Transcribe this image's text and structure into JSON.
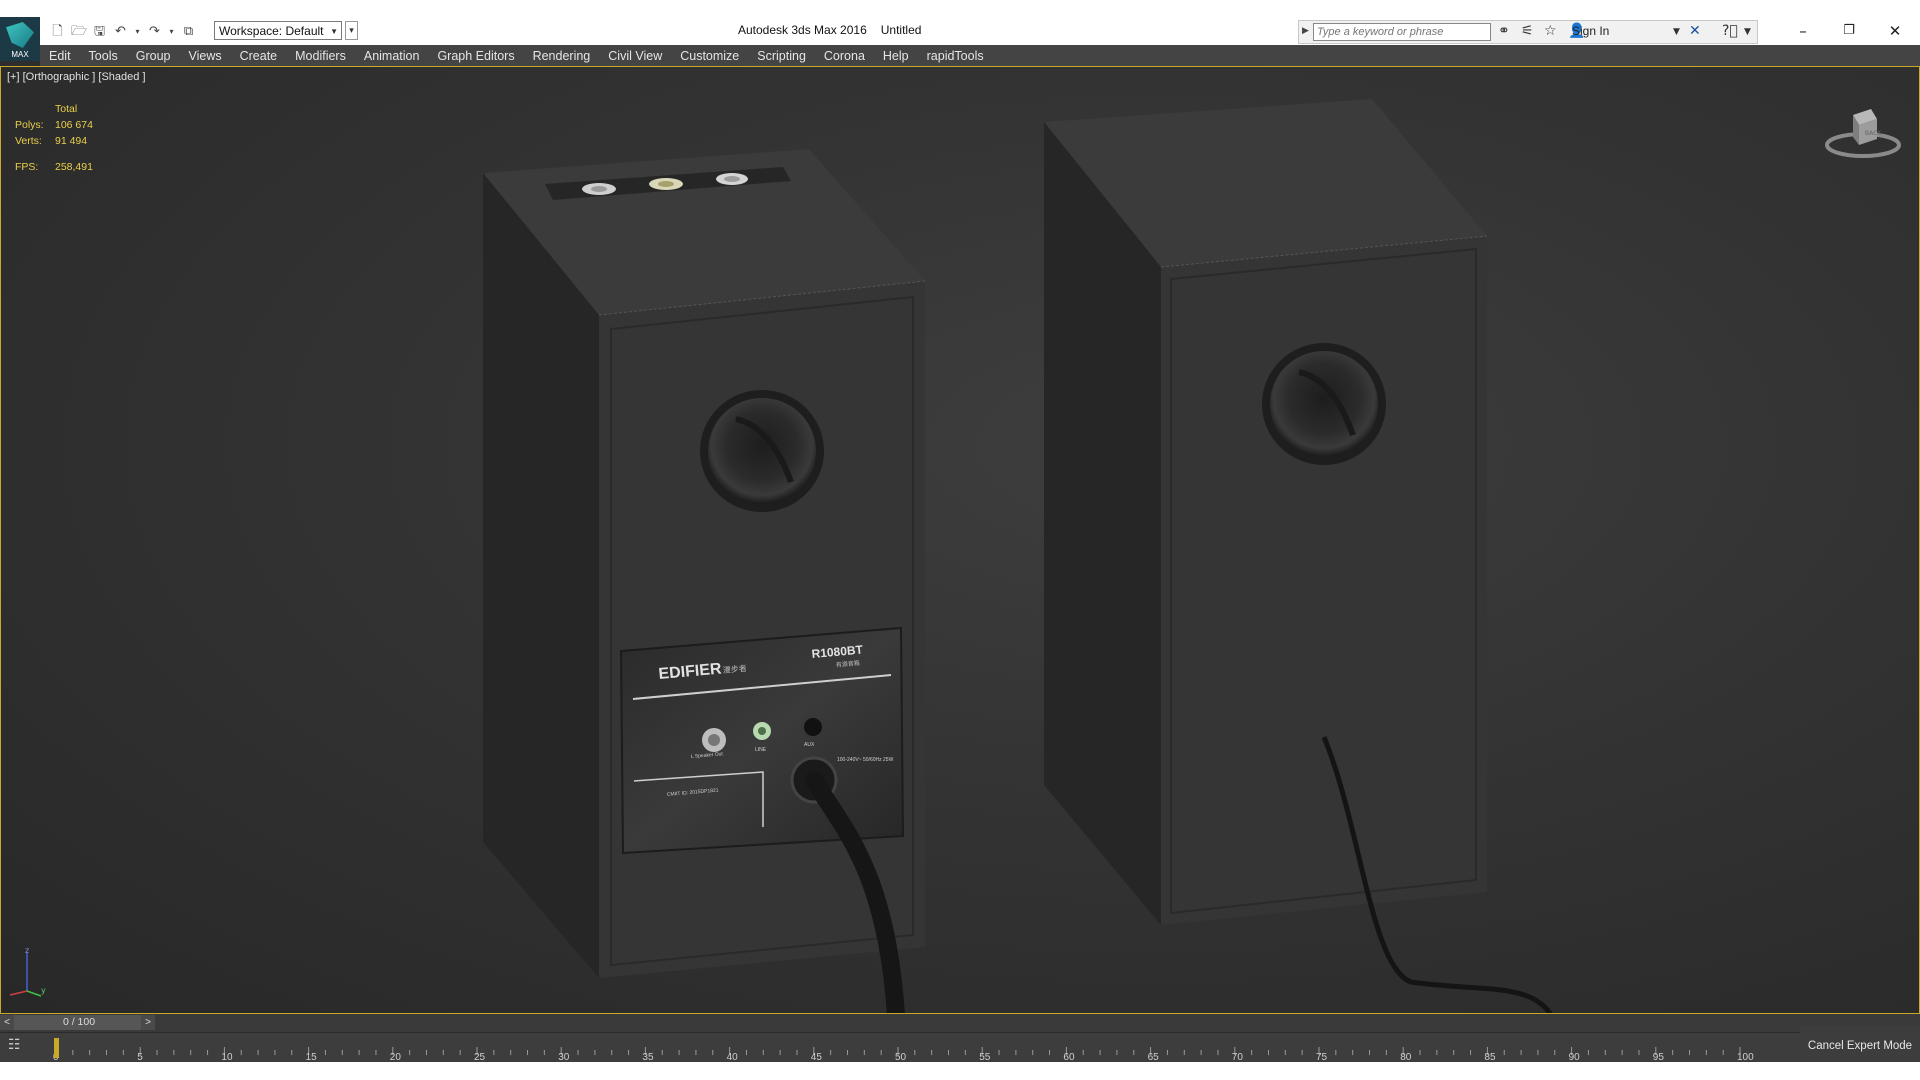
{
  "app": {
    "product": "Autodesk 3ds Max 2016",
    "document": "Untitled",
    "logo_text": "MAX"
  },
  "toolbar": {
    "workspace_label": "Workspace: Default"
  },
  "search": {
    "placeholder": "Type a keyword or phrase"
  },
  "account": {
    "sign_in_label": "Sign In"
  },
  "menu": {
    "items": [
      "Edit",
      "Tools",
      "Group",
      "Views",
      "Create",
      "Modifiers",
      "Animation",
      "Graph Editors",
      "Rendering",
      "Civil View",
      "Customize",
      "Scripting",
      "Corona",
      "Help",
      "rapidTools"
    ]
  },
  "viewport": {
    "label": "[+] [Orthographic ] [Shaded ]",
    "stats": {
      "header": "Total",
      "polys_label": "Polys:",
      "polys_value": "106 674",
      "verts_label": "Verts:",
      "verts_value": "91 494",
      "fps_label": "FPS:",
      "fps_value": "258,491"
    },
    "speaker_panel": {
      "brand": "EDIFIER",
      "brand_sub": "漫步者",
      "model": "R1080BT",
      "model_sub": "有源音箱",
      "jack_left": "L Speaker Out",
      "jack_line": "LINE",
      "jack_aux": "AUX",
      "power_spec": "100-240V~ 50/60Hz 25W",
      "cmiit": "CMIIT ID: 2015DP1821"
    }
  },
  "timeslider": {
    "prev": "<",
    "next": ">",
    "position": "0 / 100"
  },
  "timeline": {
    "ticks": [
      "0",
      "5",
      "10",
      "15",
      "20",
      "25",
      "30",
      "35",
      "40",
      "45",
      "50",
      "55",
      "60",
      "65",
      "70",
      "75",
      "80",
      "85",
      "90",
      "95",
      "100"
    ]
  },
  "status": {
    "cancel_expert_mode": "Cancel Expert Mode"
  },
  "colors": {
    "menubar": "#444444",
    "viewport_border": "#c9a92a",
    "stats_text": "#e9d04a",
    "timeline_marker": "#c9a92a"
  }
}
